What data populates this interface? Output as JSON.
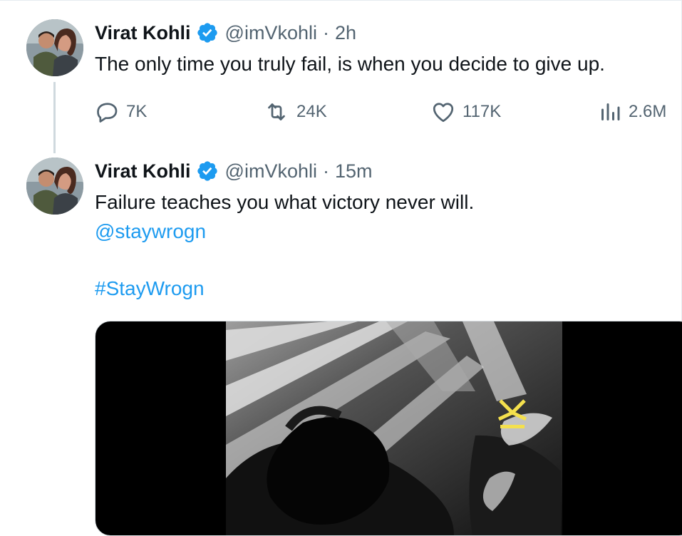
{
  "tweets": [
    {
      "name": "Virat Kohli",
      "handle": "@imVkohli",
      "separator": "·",
      "time": "2h",
      "text": "The only time you truly fail, is when you decide to give up.",
      "stats": {
        "replies": "7K",
        "retweets": "24K",
        "likes": "117K",
        "views": "2.6M"
      }
    },
    {
      "name": "Virat Kohli",
      "handle": "@imVkohli",
      "separator": "·",
      "time": "15m",
      "text": "Failure teaches you what victory never will.",
      "mention": "@staywrogn",
      "hashtag": "#StayWrogn"
    }
  ],
  "icons": {
    "verified": "verified-badge-icon",
    "reply": "reply-icon",
    "retweet": "retweet-icon",
    "like": "heart-icon",
    "views": "views-icon"
  },
  "colors": {
    "text": "#0f1419",
    "secondary": "#536471",
    "link": "#1d9bf0",
    "verified": "#1d9bf0",
    "media_logo": "#f4e04d"
  }
}
